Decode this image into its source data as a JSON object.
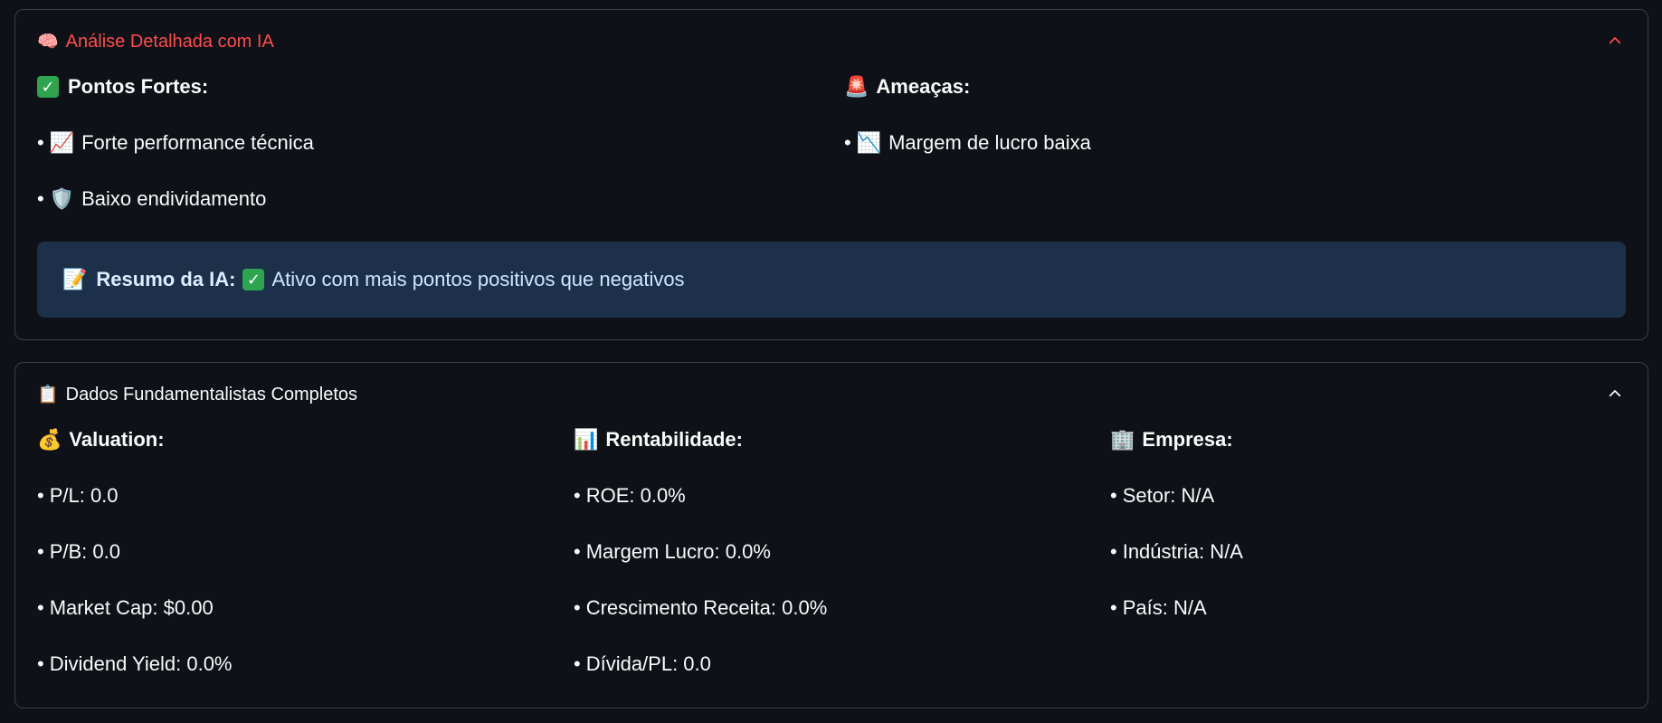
{
  "ai_section": {
    "header_icon": "🧠",
    "header_label": "Análise Detalhada com IA",
    "strengths": {
      "title_icon": "check-badge-icon",
      "title": "Pontos Fortes:",
      "items": [
        {
          "icon": "📈",
          "text": "Forte performance técnica"
        },
        {
          "icon": "🛡️",
          "text": "Baixo endividamento"
        }
      ]
    },
    "threats": {
      "title_icon": "🚨",
      "title": "Ameaças:",
      "items": [
        {
          "icon": "📉",
          "text": "Margem de lucro baixa"
        }
      ]
    },
    "summary": {
      "icon": "📝",
      "title": "Resumo da IA:",
      "check": "✓",
      "text": "Ativo com mais pontos positivos que negativos"
    }
  },
  "fund_section": {
    "header_icon": "📋",
    "header_label": "Dados Fundamentalistas Completos",
    "valuation": {
      "icon": "💰",
      "title": "Valuation:",
      "items": [
        "P/L: 0.0",
        "P/B: 0.0",
        "Market Cap: $0.00",
        "Dividend Yield: 0.0%"
      ]
    },
    "profitability": {
      "icon": "📊",
      "title": "Rentabilidade:",
      "items": [
        "ROE: 0.0%",
        "Margem Lucro: 0.0%",
        "Crescimento Receita: 0.0%",
        "Dívida/PL: 0.0"
      ]
    },
    "company": {
      "icon": "🏢",
      "title": "Empresa:",
      "items": [
        "Setor: N/A",
        "Indústria: N/A",
        "País: N/A"
      ]
    }
  },
  "bullet_char": "•",
  "colors": {
    "background": "#0e1117",
    "border": "#3a3f4b",
    "accent_red": "#ff4b4b",
    "summary_bg": "#1c3149",
    "check_green": "#2ea44f"
  }
}
